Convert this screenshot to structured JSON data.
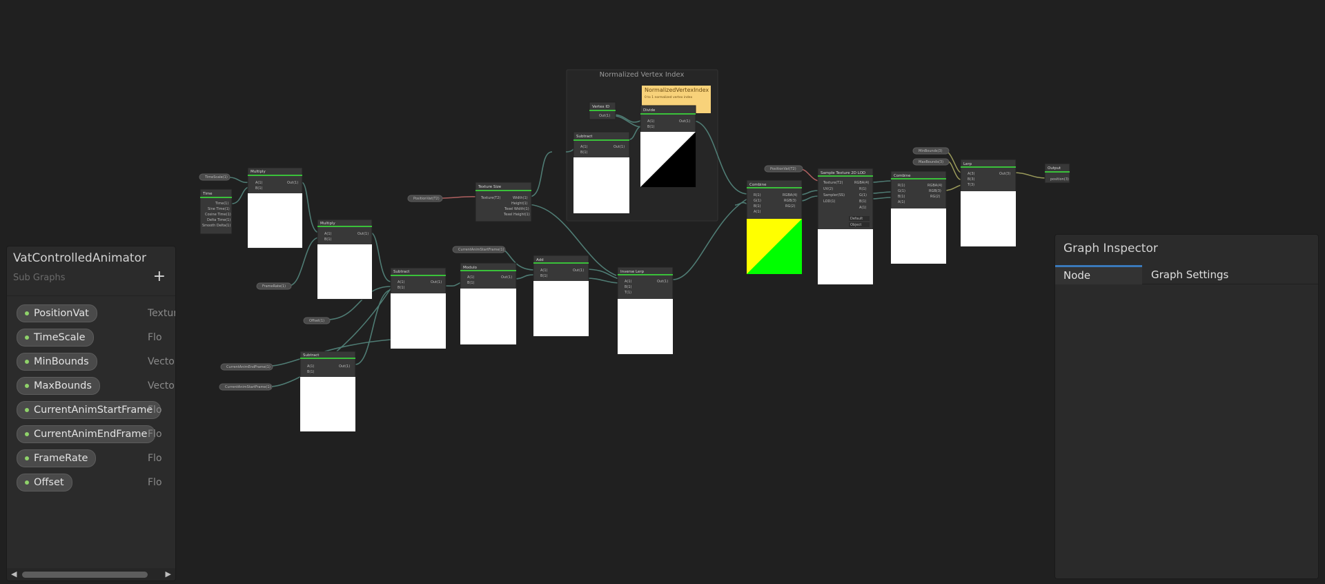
{
  "blackboard": {
    "title": "VatControlledAnimator",
    "subtitle": "Sub Graphs",
    "add_icon": "plus-icon",
    "properties": [
      {
        "name": "PositionVat",
        "type": "Texture"
      },
      {
        "name": "TimeScale",
        "type": "Flo"
      },
      {
        "name": "MinBounds",
        "type": "Vecto"
      },
      {
        "name": "MaxBounds",
        "type": "Vecto"
      },
      {
        "name": "CurrentAnimStartFrame",
        "type": "Flo"
      },
      {
        "name": "CurrentAnimEndFrame",
        "type": "Flo"
      },
      {
        "name": "FrameRate",
        "type": "Flo"
      },
      {
        "name": "Offset",
        "type": "Flo"
      }
    ]
  },
  "inspector": {
    "title": "Graph Inspector",
    "tabs": [
      {
        "label": "Node Settings",
        "active": true
      },
      {
        "label": "Graph Settings",
        "active": false
      }
    ]
  },
  "group": {
    "title": "Normalized Vertex Index"
  },
  "sticky_note": {
    "title": "NormalizedVertexIndex",
    "body": "0 to 1 normalized vertex index"
  },
  "nodes": [
    {
      "title": "Multiply",
      "ports_in": [
        "A(1)",
        "B(1)"
      ],
      "ports_out": [
        "Out(1)"
      ]
    },
    {
      "title": "Time",
      "ports_out": [
        "Time(1)",
        "Sine Time(1)",
        "Cosine Time(1)",
        "Delta Time(1)",
        "Smooth Delta(1)"
      ]
    },
    {
      "title": "Multiply",
      "ports_in": [
        "A(1)",
        "B(1)"
      ],
      "ports_out": [
        "Out(1)"
      ]
    },
    {
      "title": "Subtract",
      "ports_in": [
        "A(1)",
        "B(1)"
      ],
      "ports_out": [
        "Out(1)"
      ]
    },
    {
      "title": "Subtract",
      "ports_in": [
        "A(1)",
        "B(1)"
      ],
      "ports_out": [
        "Out(1)"
      ]
    },
    {
      "title": "Modulo",
      "ports_in": [
        "A(1)",
        "B(1)"
      ],
      "ports_out": [
        "Out(1)"
      ]
    },
    {
      "title": "Add",
      "ports_in": [
        "A(1)",
        "B(1)"
      ],
      "ports_out": [
        "Out(1)"
      ]
    },
    {
      "title": "Texture Size",
      "ports_in": [
        "Texture(T2)"
      ],
      "ports_out": [
        "Width(1)",
        "Height(1)",
        "Texel Width(1)",
        "Texel Height(1)"
      ]
    },
    {
      "title": "Vertex ID",
      "ports_out": [
        "Out(1)"
      ]
    },
    {
      "title": "Subtract",
      "ports_in": [
        "A(1)",
        "B(1)"
      ],
      "ports_out": [
        "Out(1)"
      ]
    },
    {
      "title": "Divide",
      "ports_in": [
        "A(1)",
        "B(1)"
      ],
      "ports_out": [
        "Out(1)"
      ]
    },
    {
      "title": "Inverse Lerp",
      "ports_in": [
        "A(1)",
        "B(1)",
        "T(1)"
      ],
      "ports_out": [
        "Out(1)"
      ]
    },
    {
      "title": "Combine",
      "ports_in": [
        "R(1)",
        "G(1)",
        "B(1)",
        "A(1)"
      ],
      "ports_out": [
        "RGBA(4)",
        "RGB(3)",
        "RG(2)"
      ]
    },
    {
      "title": "Sample Texture 2D LOD",
      "ports_in": [
        "Texture(T2)",
        "UV(2)",
        "Sampler(SS)",
        "LOD(1)"
      ],
      "ports_out": [
        "RGBA(4)",
        "R(1)",
        "G(1)",
        "B(1)",
        "A(1)"
      ]
    },
    {
      "title": "Combine",
      "ports_in": [
        "R(1)",
        "G(1)",
        "B(1)",
        "A(1)"
      ],
      "ports_out": [
        "RGBA(4)",
        "RGB(3)",
        "RG(2)"
      ]
    },
    {
      "title": "Lerp",
      "ports_in": [
        "A(3)",
        "B(3)",
        "T(3)"
      ],
      "ports_out": [
        "Out(3)"
      ]
    },
    {
      "title": "Output",
      "ports_in": [
        "position(3)"
      ]
    }
  ],
  "property_chips": [
    "TimeScale(1)",
    "FrameRate(1)",
    "Offset(1)",
    "CurrentAnimEndFrame(1)",
    "CurrentAnimStartFrame(1)",
    "CurrentAnimStartFrame(1)",
    "PositionVat(T2)",
    "PositionVat(T2)",
    "MinBounds(3)",
    "MaxBounds(3)"
  ],
  "sampler_options": [
    "Default",
    "Object"
  ]
}
